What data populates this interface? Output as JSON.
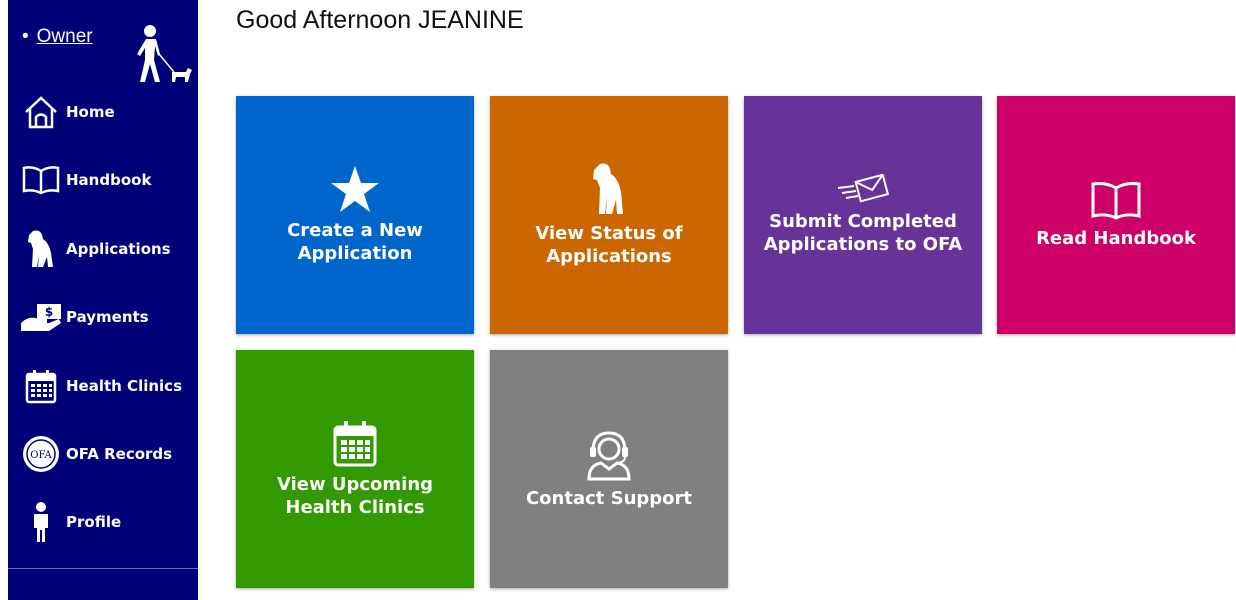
{
  "sidebar": {
    "owner_link": "Owner",
    "items": [
      {
        "label": "Home",
        "icon": "home-icon"
      },
      {
        "label": "Handbook",
        "icon": "book-icon"
      },
      {
        "label": "Applications",
        "icon": "dog-icon"
      },
      {
        "label": "Payments",
        "icon": "payment-icon"
      },
      {
        "label": "Health Clinics",
        "icon": "calendar-icon"
      },
      {
        "label": "OFA Records",
        "icon": "ofa-seal-icon"
      },
      {
        "label": "Profile",
        "icon": "person-icon"
      }
    ],
    "background": "#000078"
  },
  "greeting": "Good Afternoon JEANINE",
  "tiles": [
    {
      "label": "Create a New Application",
      "color": "#0066cc",
      "icon": "star-icon"
    },
    {
      "label": "View Status of Applications",
      "color": "#cc6600",
      "icon": "dog-icon"
    },
    {
      "label": "Submit Completed Applications to OFA",
      "color": "#663399",
      "icon": "envelope-icon"
    },
    {
      "label": "Read Handbook",
      "color": "#cc0066",
      "icon": "book-icon"
    },
    {
      "label": "View Upcoming Health Clinics",
      "color": "#339900",
      "icon": "calendar-icon"
    },
    {
      "label": "Contact Support",
      "color": "#808080",
      "icon": "headset-icon"
    }
  ]
}
